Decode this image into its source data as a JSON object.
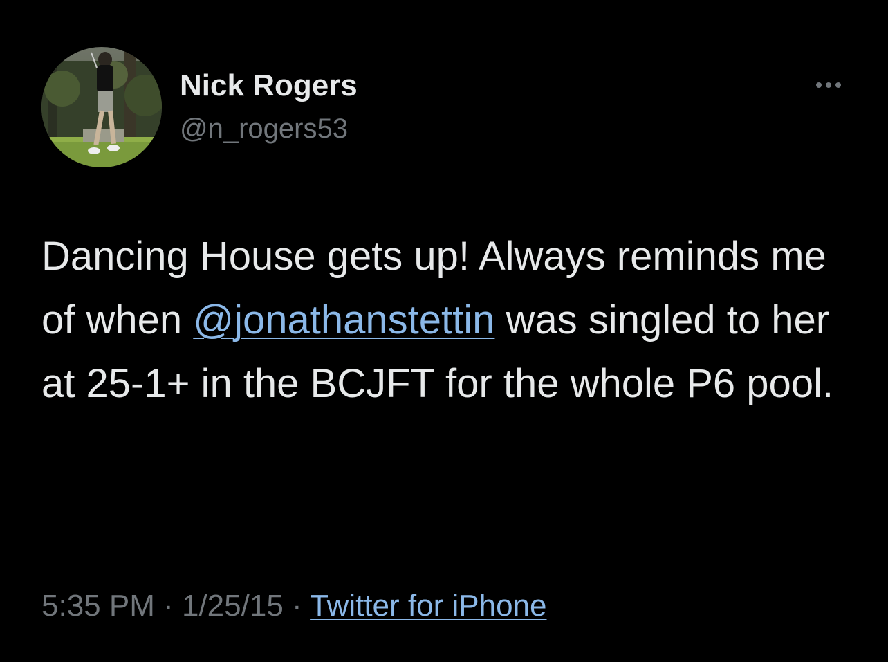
{
  "author": {
    "display_name": "Nick Rogers",
    "handle": "@n_rogers53",
    "avatar_icon": "profile-photo-golfer"
  },
  "more_icon": "more-horizontal-icon",
  "tweet": {
    "text_before": "Dancing House gets up! Always reminds me of when ",
    "mention": "@jonathanstettin",
    "text_after": " was singled to her at 25-1+ in the BCJFT for the whole P6 pool."
  },
  "meta": {
    "time": "5:35 PM",
    "sep1": " · ",
    "date": "1/25/15",
    "sep2": " · ",
    "source": "Twitter for iPhone"
  },
  "colors": {
    "background": "#000000",
    "primary_text": "#e7e9ea",
    "secondary_text": "#71767b",
    "link": "#8bb8e8",
    "divider": "#2f3336"
  }
}
